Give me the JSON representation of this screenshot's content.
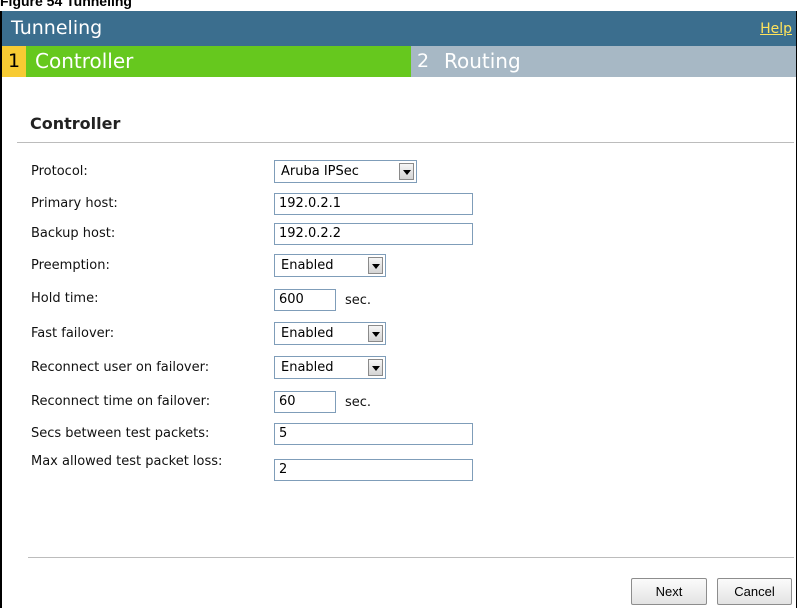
{
  "figure_caption": "Figure 54 Tunneling",
  "dialog": {
    "title": "Tunneling",
    "help_link": "Help"
  },
  "steps": [
    {
      "number": "1",
      "label": "Controller",
      "active": true
    },
    {
      "number": "2",
      "label": "Routing",
      "active": false
    }
  ],
  "section_title": "Controller",
  "fields": {
    "protocol": {
      "label": "Protocol:",
      "value": "Aruba IPSec"
    },
    "primary_host": {
      "label": "Primary host:",
      "value": "192.0.2.1"
    },
    "backup_host": {
      "label": "Backup host:",
      "value": "192.0.2.2"
    },
    "preemption": {
      "label": "Preemption:",
      "value": "Enabled"
    },
    "hold_time": {
      "label": "Hold time:",
      "value": "600",
      "unit": "sec."
    },
    "fast_failover": {
      "label": "Fast failover:",
      "value": "Enabled"
    },
    "reconnect_user": {
      "label": "Reconnect user on failover:",
      "value": "Enabled"
    },
    "reconnect_time": {
      "label": "Reconnect time on failover:",
      "value": "60",
      "unit": "sec."
    },
    "secs_between": {
      "label": "Secs between test packets:",
      "value": "5"
    },
    "max_loss": {
      "label": "Max allowed test packet loss:",
      "value": "2"
    }
  },
  "buttons": {
    "next": "Next",
    "cancel": "Cancel"
  },
  "colors": {
    "titlebar": "#3b6e8e",
    "help_link": "#ffe35c",
    "step_active_number": "#f7cb33",
    "step_active": "#66c81e",
    "step_inactive": "#a7b8c5"
  }
}
